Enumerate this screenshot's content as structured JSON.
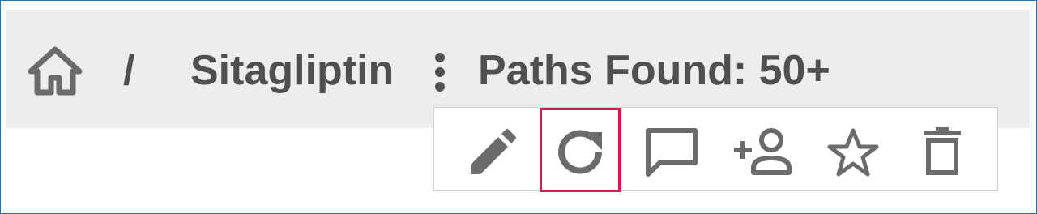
{
  "breadcrumb": {
    "separator": "/",
    "item": "Sitagliptin",
    "status": "Paths Found: 50+"
  },
  "toolbar": {
    "actions": [
      {
        "icon": "pencil-icon",
        "label": "edit"
      },
      {
        "icon": "refresh-icon",
        "label": "refresh",
        "highlighted": true
      },
      {
        "icon": "comment-icon",
        "label": "comment"
      },
      {
        "icon": "add-user-icon",
        "label": "share"
      },
      {
        "icon": "star-icon",
        "label": "favorite"
      },
      {
        "icon": "trash-icon",
        "label": "delete"
      }
    ]
  },
  "colors": {
    "header_bg": "#ededed",
    "text": "#505050",
    "icon": "#6b6b6b",
    "highlight": "#d01f4f",
    "frame": "#2f6fa3"
  }
}
